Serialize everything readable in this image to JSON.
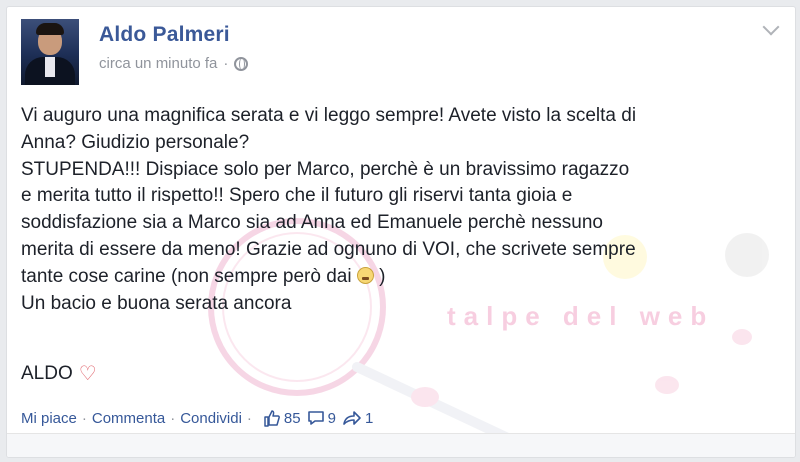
{
  "post": {
    "author": "Aldo Palmeri",
    "time": "circa un minuto fa",
    "separator": "·",
    "body": "Vi auguro una magnifica serata e vi leggo sempre! Avete visto la scelta di\nAnna? Giudizio personale?\nSTUPENDA!!! Dispiace solo per Marco, perchè è un bravissimo ragazzo\ne merita tutto il rispetto!! Spero che il futuro gli riservi tanta gioia e\nsoddisfazione sia a Marco sia ad Anna ed Emanuele perchè nessuno\nmerita di essere da meno! Grazie ad ognuno di VOI, che scrivete sempre\ntante cose carine (non sempre però dai ",
    "body_close": " )\nUn bacio e buona serata ancora",
    "signature": "ALDO",
    "heart": "♡"
  },
  "actions": {
    "like": "Mi piace",
    "comment": "Commenta",
    "share": "Condividi",
    "likes_count": "85",
    "comments_count": "9",
    "shares_count": "1"
  },
  "watermark": {
    "text": "talpe del web"
  },
  "colors": {
    "accent": "#3b5998",
    "link": "#365899",
    "meta": "#90949c",
    "watermark": "#f2a7c8"
  }
}
